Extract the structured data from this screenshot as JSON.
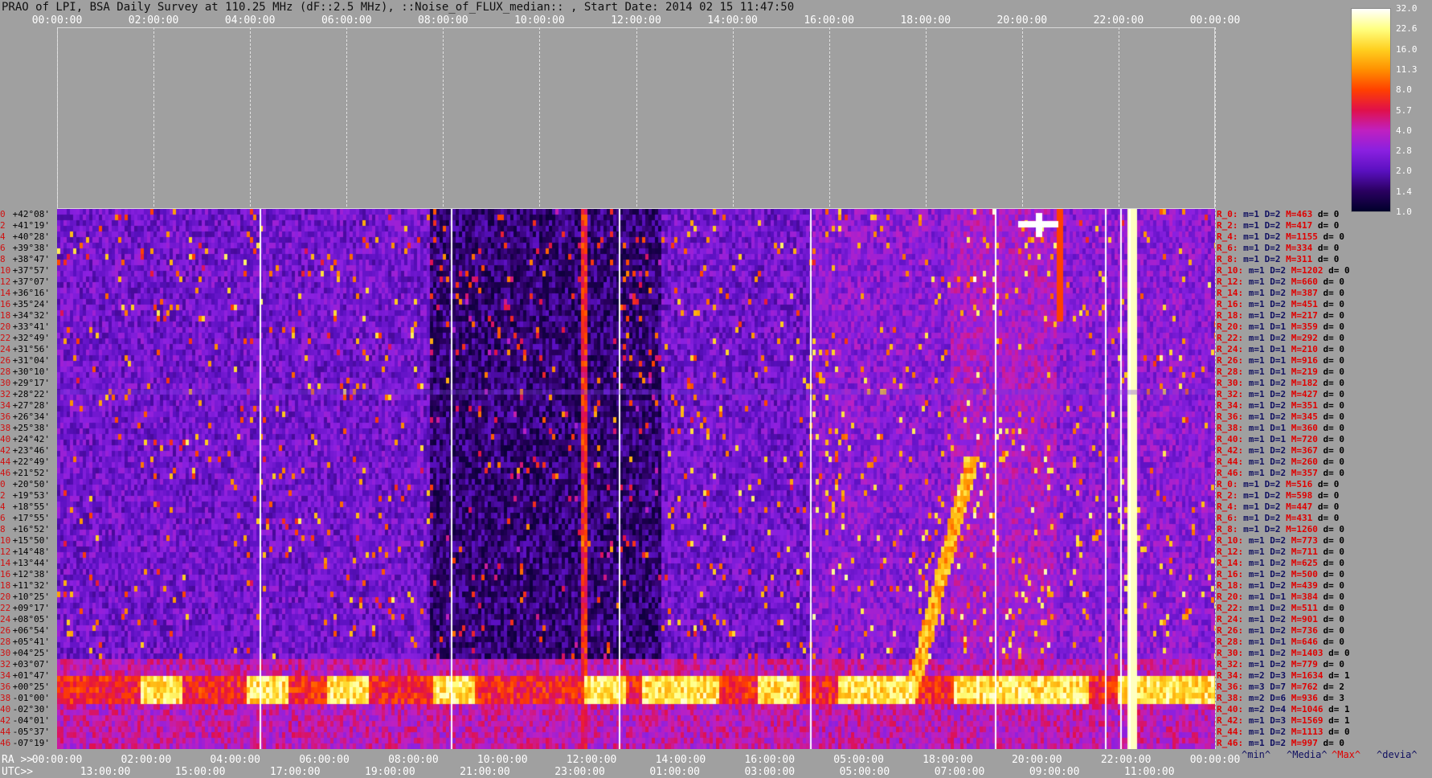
{
  "title": "PRAO of LPI, BSA Daily Survey at 110.25 MHz (dF::2.5 MHz), ::Noise_of_FLUX_median:: , Start Date: 2014 02 15 11:47:50",
  "top_axis_ticks": [
    "00:00:00",
    "02:00:00",
    "04:00:00",
    "06:00:00",
    "08:00:00",
    "10:00:00",
    "12:00:00",
    "14:00:00",
    "16:00:00",
    "18:00:00",
    "20:00:00",
    "22:00:00",
    "00:00:00"
  ],
  "bottom_axis": {
    "ra_prefix": "RA >>",
    "utc_prefix": "UTC>>",
    "ra_ticks": [
      "00:00:00",
      "02:00:00",
      "04:00:00",
      "06:00:00",
      "08:00:00",
      "10:00:00",
      "12:00:00",
      "14:00:00",
      "16:00:00",
      "05:00:00",
      "18:00:00",
      "20:00:00",
      "22:00:00",
      "00:00:00"
    ],
    "utc_ticks": [
      "13:00:00",
      "15:00:00",
      "17:00:00",
      "19:00:00",
      "21:00:00",
      "23:00:00",
      "01:00:00",
      "03:00:00",
      "05:00:00",
      "07:00:00",
      "09:00:00",
      "11:00:00"
    ]
  },
  "legend": {
    "scale_labels": [
      "32.0",
      "22.6",
      "16.0",
      "11.3",
      "8.0",
      "5.7",
      "4.0",
      "2.8",
      "2.0",
      "1.4",
      "1.0"
    ],
    "stats": [
      "^min^",
      "^Media^",
      "^Max^",
      "^devia^"
    ],
    "colors": [
      "#00002a",
      "#2a0060",
      "#5a10c0",
      "#8a20e0",
      "#c020c0",
      "#e0104a",
      "#ff4000",
      "#ff9000",
      "#ffd020",
      "#ffff80",
      "#ffffff"
    ]
  },
  "declinations": [
    {
      "idx": "0",
      "dec": "+42°08'"
    },
    {
      "idx": "2",
      "dec": "+41°19'"
    },
    {
      "idx": "4",
      "dec": "+40°28'"
    },
    {
      "idx": "6",
      "dec": "+39°38'"
    },
    {
      "idx": "8",
      "dec": "+38°47'"
    },
    {
      "idx": "10",
      "dec": "+37°57'"
    },
    {
      "idx": "12",
      "dec": "+37°07'"
    },
    {
      "idx": "14",
      "dec": "+36°16'"
    },
    {
      "idx": "16",
      "dec": "+35°24'"
    },
    {
      "idx": "18",
      "dec": "+34°32'"
    },
    {
      "idx": "20",
      "dec": "+33°41'"
    },
    {
      "idx": "22",
      "dec": "+32°49'"
    },
    {
      "idx": "24",
      "dec": "+31°56'"
    },
    {
      "idx": "26",
      "dec": "+31°04'"
    },
    {
      "idx": "28",
      "dec": "+30°10'"
    },
    {
      "idx": "30",
      "dec": "+29°17'"
    },
    {
      "idx": "32",
      "dec": "+28°22'"
    },
    {
      "idx": "34",
      "dec": "+27°28'"
    },
    {
      "idx": "36",
      "dec": "+26°34'"
    },
    {
      "idx": "38",
      "dec": "+25°38'"
    },
    {
      "idx": "40",
      "dec": "+24°42'"
    },
    {
      "idx": "42",
      "dec": "+23°46'"
    },
    {
      "idx": "44",
      "dec": "+22°49'"
    },
    {
      "idx": "46",
      "dec": "+21°52'"
    },
    {
      "idx": "0",
      "dec": "+20°50'"
    },
    {
      "idx": "2",
      "dec": "+19°53'"
    },
    {
      "idx": "4",
      "dec": "+18°55'"
    },
    {
      "idx": "6",
      "dec": "+17°55'"
    },
    {
      "idx": "8",
      "dec": "+16°52'"
    },
    {
      "idx": "10",
      "dec": "+15°50'"
    },
    {
      "idx": "12",
      "dec": "+14°48'"
    },
    {
      "idx": "14",
      "dec": "+13°44'"
    },
    {
      "idx": "16",
      "dec": "+12°38'"
    },
    {
      "idx": "18",
      "dec": "+11°32'"
    },
    {
      "idx": "20",
      "dec": "+10°25'"
    },
    {
      "idx": "22",
      "dec": "+09°17'"
    },
    {
      "idx": "24",
      "dec": "+08°05'"
    },
    {
      "idx": "26",
      "dec": "+06°54'"
    },
    {
      "idx": "28",
      "dec": "+05°41'"
    },
    {
      "idx": "30",
      "dec": "+04°25'"
    },
    {
      "idx": "32",
      "dec": "+03°07'"
    },
    {
      "idx": "34",
      "dec": "+01°47'"
    },
    {
      "idx": "36",
      "dec": "+00°25'"
    },
    {
      "idx": "38",
      "dec": "-01°00'"
    },
    {
      "idx": "40",
      "dec": "-02°30'"
    },
    {
      "idx": "42",
      "dec": "-04°01'"
    },
    {
      "idx": "44",
      "dec": "-05°37'"
    },
    {
      "idx": "46",
      "dec": "-07°19'"
    }
  ],
  "row_stats": [
    {
      "r": "R_0:",
      "m": "m=1",
      "d": "D=2",
      "mx": "M=463",
      "dv": "d= 0"
    },
    {
      "r": "R_2:",
      "m": "m=1",
      "d": "D=2",
      "mx": "M=417",
      "dv": "d= 0"
    },
    {
      "r": "R_4:",
      "m": "m=1",
      "d": "D=2",
      "mx": "M=1155",
      "dv": "d= 0"
    },
    {
      "r": "R_6:",
      "m": "m=1",
      "d": "D=2",
      "mx": "M=334",
      "dv": "d= 0"
    },
    {
      "r": "R_8:",
      "m": "m=1",
      "d": "D=2",
      "mx": "M=311",
      "dv": "d= 0"
    },
    {
      "r": "R_10:",
      "m": "m=1",
      "d": "D=2",
      "mx": "M=1202",
      "dv": "d= 0"
    },
    {
      "r": "R_12:",
      "m": "m=1",
      "d": "D=2",
      "mx": "M=660",
      "dv": "d= 0"
    },
    {
      "r": "R_14:",
      "m": "m=1",
      "d": "D=2",
      "mx": "M=387",
      "dv": "d= 0"
    },
    {
      "r": "R_16:",
      "m": "m=1",
      "d": "D=2",
      "mx": "M=451",
      "dv": "d= 0"
    },
    {
      "r": "R_18:",
      "m": "m=1",
      "d": "D=2",
      "mx": "M=217",
      "dv": "d= 0"
    },
    {
      "r": "R_20:",
      "m": "m=1",
      "d": "D=1",
      "mx": "M=359",
      "dv": "d= 0"
    },
    {
      "r": "R_22:",
      "m": "m=1",
      "d": "D=2",
      "mx": "M=292",
      "dv": "d= 0"
    },
    {
      "r": "R_24:",
      "m": "m=1",
      "d": "D=1",
      "mx": "M=210",
      "dv": "d= 0"
    },
    {
      "r": "R_26:",
      "m": "m=1",
      "d": "D=1",
      "mx": "M=916",
      "dv": "d= 0"
    },
    {
      "r": "R_28:",
      "m": "m=1",
      "d": "D=1",
      "mx": "M=219",
      "dv": "d= 0"
    },
    {
      "r": "R_30:",
      "m": "m=1",
      "d": "D=2",
      "mx": "M=182",
      "dv": "d= 0"
    },
    {
      "r": "R_32:",
      "m": "m=1",
      "d": "D=2",
      "mx": "M=427",
      "dv": "d= 0"
    },
    {
      "r": "R_34:",
      "m": "m=1",
      "d": "D=2",
      "mx": "M=351",
      "dv": "d= 0"
    },
    {
      "r": "R_36:",
      "m": "m=1",
      "d": "D=2",
      "mx": "M=345",
      "dv": "d= 0"
    },
    {
      "r": "R_38:",
      "m": "m=1",
      "d": "D=1",
      "mx": "M=360",
      "dv": "d= 0"
    },
    {
      "r": "R_40:",
      "m": "m=1",
      "d": "D=1",
      "mx": "M=720",
      "dv": "d= 0"
    },
    {
      "r": "R_42:",
      "m": "m=1",
      "d": "D=2",
      "mx": "M=367",
      "dv": "d= 0"
    },
    {
      "r": "R_44:",
      "m": "m=1",
      "d": "D=2",
      "mx": "M=260",
      "dv": "d= 0"
    },
    {
      "r": "R_46:",
      "m": "m=1",
      "d": "D=2",
      "mx": "M=357",
      "dv": "d= 0"
    },
    {
      "r": "R_0:",
      "m": "m=1",
      "d": "D=2",
      "mx": "M=516",
      "dv": "d= 0"
    },
    {
      "r": "R_2:",
      "m": "m=1",
      "d": "D=2",
      "mx": "M=598",
      "dv": "d= 0"
    },
    {
      "r": "R_4:",
      "m": "m=1",
      "d": "D=2",
      "mx": "M=447",
      "dv": "d= 0"
    },
    {
      "r": "R_6:",
      "m": "m=1",
      "d": "D=2",
      "mx": "M=431",
      "dv": "d= 0"
    },
    {
      "r": "R_8:",
      "m": "m=1",
      "d": "D=2",
      "mx": "M=1260",
      "dv": "d= 0"
    },
    {
      "r": "R_10:",
      "m": "m=1",
      "d": "D=2",
      "mx": "M=773",
      "dv": "d= 0"
    },
    {
      "r": "R_12:",
      "m": "m=1",
      "d": "D=2",
      "mx": "M=711",
      "dv": "d= 0"
    },
    {
      "r": "R_14:",
      "m": "m=1",
      "d": "D=2",
      "mx": "M=625",
      "dv": "d= 0"
    },
    {
      "r": "R_16:",
      "m": "m=1",
      "d": "D=2",
      "mx": "M=500",
      "dv": "d= 0"
    },
    {
      "r": "R_18:",
      "m": "m=1",
      "d": "D=2",
      "mx": "M=439",
      "dv": "d= 0"
    },
    {
      "r": "R_20:",
      "m": "m=1",
      "d": "D=1",
      "mx": "M=384",
      "dv": "d= 0"
    },
    {
      "r": "R_22:",
      "m": "m=1",
      "d": "D=2",
      "mx": "M=511",
      "dv": "d= 0"
    },
    {
      "r": "R_24:",
      "m": "m=1",
      "d": "D=2",
      "mx": "M=901",
      "dv": "d= 0"
    },
    {
      "r": "R_26:",
      "m": "m=1",
      "d": "D=2",
      "mx": "M=736",
      "dv": "d= 0"
    },
    {
      "r": "R_28:",
      "m": "m=1",
      "d": "D=1",
      "mx": "M=646",
      "dv": "d= 0"
    },
    {
      "r": "R_30:",
      "m": "m=1",
      "d": "D=2",
      "mx": "M=1403",
      "dv": "d= 0"
    },
    {
      "r": "R_32:",
      "m": "m=1",
      "d": "D=2",
      "mx": "M=779",
      "dv": "d= 0"
    },
    {
      "r": "R_34:",
      "m": "m=2",
      "d": "D=3",
      "mx": "M=1634",
      "dv": "d= 1"
    },
    {
      "r": "R_36:",
      "m": "m=3",
      "d": "D=7",
      "mx": "M=762",
      "dv": "d= 2"
    },
    {
      "r": "R_38:",
      "m": "m=2",
      "d": "D=6",
      "mx": "M=936",
      "dv": "d= 3"
    },
    {
      "r": "R_40:",
      "m": "m=2",
      "d": "D=4",
      "mx": "M=1046",
      "dv": "d= 1"
    },
    {
      "r": "R_42:",
      "m": "m=1",
      "d": "D=3",
      "mx": "M=1569",
      "dv": "d= 1"
    },
    {
      "r": "R_44:",
      "m": "m=1",
      "d": "D=2",
      "mx": "M=1113",
      "dv": "d= 0"
    },
    {
      "r": "R_46:",
      "m": "m=1",
      "d": "D=2",
      "mx": "M=997",
      "dv": "d= 0"
    }
  ]
}
